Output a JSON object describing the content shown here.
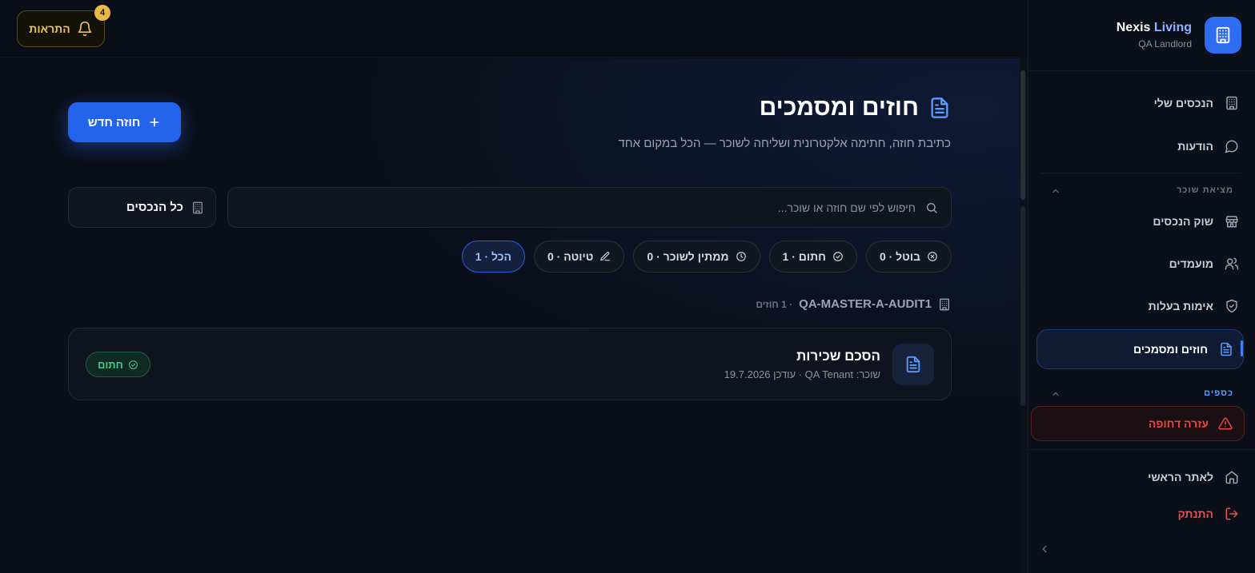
{
  "notifications": {
    "label": "התראות",
    "count": "4"
  },
  "page": {
    "title": "חוזים ומסמכים",
    "subtitle": "כתיבת חוזה, חתימה אלקטרונית ושליחה לשוכר — הכל במקום אחד",
    "new_button": "חוזה חדש"
  },
  "search": {
    "placeholder": "חיפוש לפי שם חוזה או שוכר..."
  },
  "property_filter": {
    "label": "כל הנכסים"
  },
  "filters": [
    {
      "label": "הכל · 1",
      "icon": "none",
      "active": true
    },
    {
      "label": "טיוטה · 0",
      "icon": "pencil-icon",
      "active": false
    },
    {
      "label": "ממתין לשוכר · 0",
      "icon": "clock-icon",
      "active": false
    },
    {
      "label": "חתום · 1",
      "icon": "check-circle-icon",
      "active": false
    },
    {
      "label": "בוטל · 0",
      "icon": "x-circle-icon",
      "active": false
    }
  ],
  "group": {
    "property_name": "QA-MASTER-A-AUDIT1",
    "count": "· 1 חוזים"
  },
  "contract": {
    "title": "הסכם שכירות",
    "meta": "שוכר: QA Tenant · עודכן 19.7.2026",
    "status": "חתום",
    "status_color": "#3ecf8e"
  },
  "sidebar": {
    "brand_name_1": "Nexis",
    "brand_name_2": " Living",
    "brand_sub": "QA Landlord",
    "items_top": [
      {
        "label": "הנכסים שלי",
        "icon": "building-icon"
      },
      {
        "label": "הודעות",
        "icon": "message-icon"
      }
    ],
    "section_tenant": "מציאת שוכר",
    "items_tenant": [
      {
        "label": "שוק הנכסים",
        "icon": "store-icon"
      },
      {
        "label": "מועמדים",
        "icon": "users-icon"
      },
      {
        "label": "אימות בעלות",
        "icon": "shield-check-icon"
      },
      {
        "label": "חוזים ומסמכים",
        "icon": "document-icon",
        "active": true
      }
    ],
    "section_money": "כספים",
    "emergency": "עזרה דחופה",
    "home": "לאתר הראשי",
    "logout": "התנתק"
  },
  "colors": {
    "accent": "#2463eb",
    "danger": "#ef4444",
    "gold": "#e8b84a"
  }
}
